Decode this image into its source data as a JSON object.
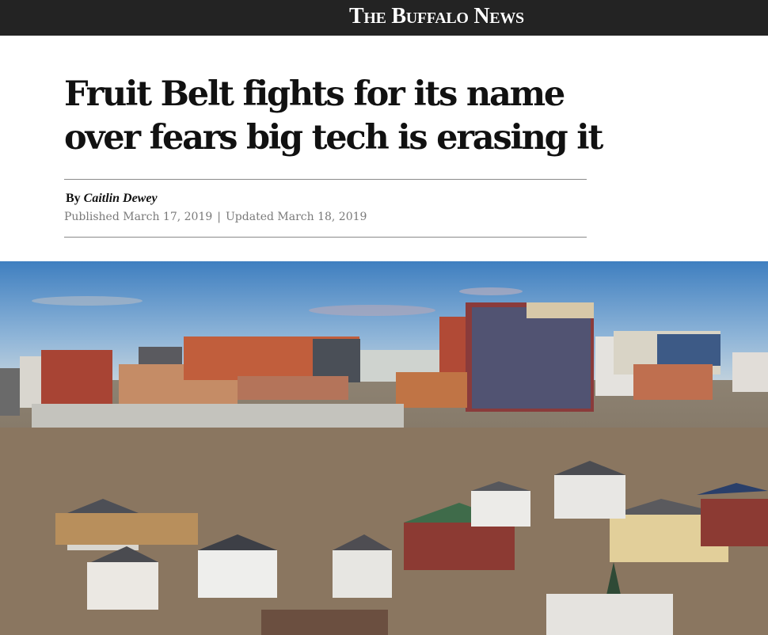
{
  "masthead": {
    "title": "The Buffalo News"
  },
  "article": {
    "headline": "Fruit Belt fights for its name over fears big tech is erasing it",
    "byline_prefix": "By",
    "author": "Caitlin Dewey",
    "published": "Published March 17, 2019",
    "separator": "|",
    "updated": "Updated March 18, 2019"
  },
  "colors": {
    "topbar": "#232323",
    "headline": "#111111",
    "meta_gray": "#7a7a7a",
    "rule": "#8a8a8a"
  }
}
